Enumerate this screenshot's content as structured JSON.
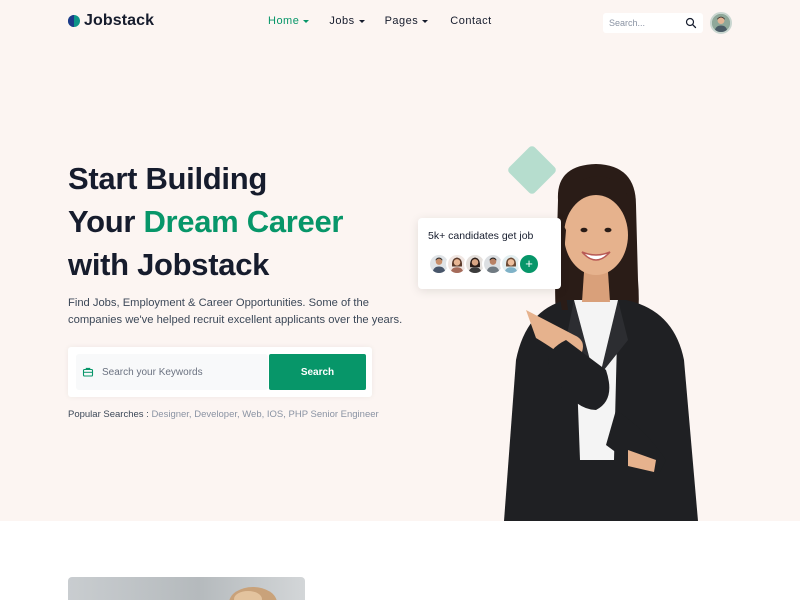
{
  "brand": {
    "name": "Jobstack"
  },
  "nav": {
    "items": [
      {
        "label": "Home",
        "has_caret": true,
        "active": true
      },
      {
        "label": "Jobs",
        "has_caret": true,
        "active": false
      },
      {
        "label": "Pages",
        "has_caret": true,
        "active": false
      },
      {
        "label": "Contact",
        "has_caret": false,
        "active": false
      }
    ],
    "search_placeholder": "Search..."
  },
  "hero": {
    "headline_line1": "Start Building",
    "headline_line2_prefix": "Your ",
    "headline_line2_accent": "Dream Career",
    "headline_line3": "with Jobstack",
    "subtext": "Find Jobs, Employment & Career Opportunities. Some of the companies we've helped recruit excellent applicants over the years.",
    "keyword_placeholder": "Search your Keywords",
    "search_button": "Search",
    "popular_label": "Popular Searches :",
    "popular_tags": "Designer, Developer, Web, IOS, PHP Senior Engineer"
  },
  "candidates_card": {
    "text": "5k+ candidates get job",
    "plus": "+"
  },
  "icons": {
    "search": "search-icon",
    "briefcase": "briefcase-icon",
    "caret": "chevron-down-icon"
  },
  "colors": {
    "accent": "#079669",
    "hero_bg": "#fcf5f2",
    "text_dark": "#161c2d"
  }
}
